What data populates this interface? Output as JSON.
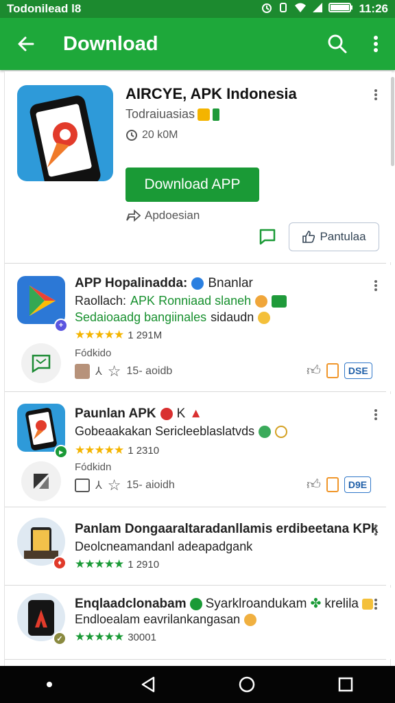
{
  "status_bar": {
    "left_text": "Todonilead l8",
    "time": "11:26"
  },
  "app_bar": {
    "title": "Download"
  },
  "featured": {
    "title": "AIRCYE, APK Indonesia",
    "subtitle": "Todraiuasias",
    "size": "20 k0M",
    "download_label": "Download APP",
    "share_label": "Apdoesian",
    "rate_label": "Pantulaa"
  },
  "list": [
    {
      "line1": "APP Hopalinadda:",
      "line1_suffix": "Bnanlar",
      "line2_prefix": "Raollach:",
      "line2": "APK Ronniaad slaneh",
      "line3": "Sedaioaadg bangiinales",
      "line3_suffix": "sidaudn",
      "rating": "1 291M",
      "sub_label": "Fódkido",
      "actions_count": "15- aoidb",
      "tag": "DSE"
    },
    {
      "line1": "Paunlan APK",
      "line1_suffix": "K",
      "line2": "Gobeaakakan Sericleeblaslatvds",
      "rating": "1 2310",
      "sub_label": "Fódkidn",
      "actions_count": "15- aioidh",
      "tag": "D9E"
    },
    {
      "line1": "Panlam Dongaaraltaradanllamis erdibeetana KPk",
      "line2": "Deolcneamandanl adeapadgank",
      "rating": "1 2910"
    },
    {
      "line1": "Enqlaadclonabam",
      "line1_suffix": "Syarklroandukam",
      "line1_suffix2": "krelila",
      "line2": "Endloealam eavrilankangasan",
      "rating": "30001"
    }
  ],
  "colors": {
    "primary": "#1ea83a",
    "status": "#1c8a2f",
    "button": "#1a9a36",
    "star": "#f4b400",
    "tag_blue": "#2f77c9"
  }
}
